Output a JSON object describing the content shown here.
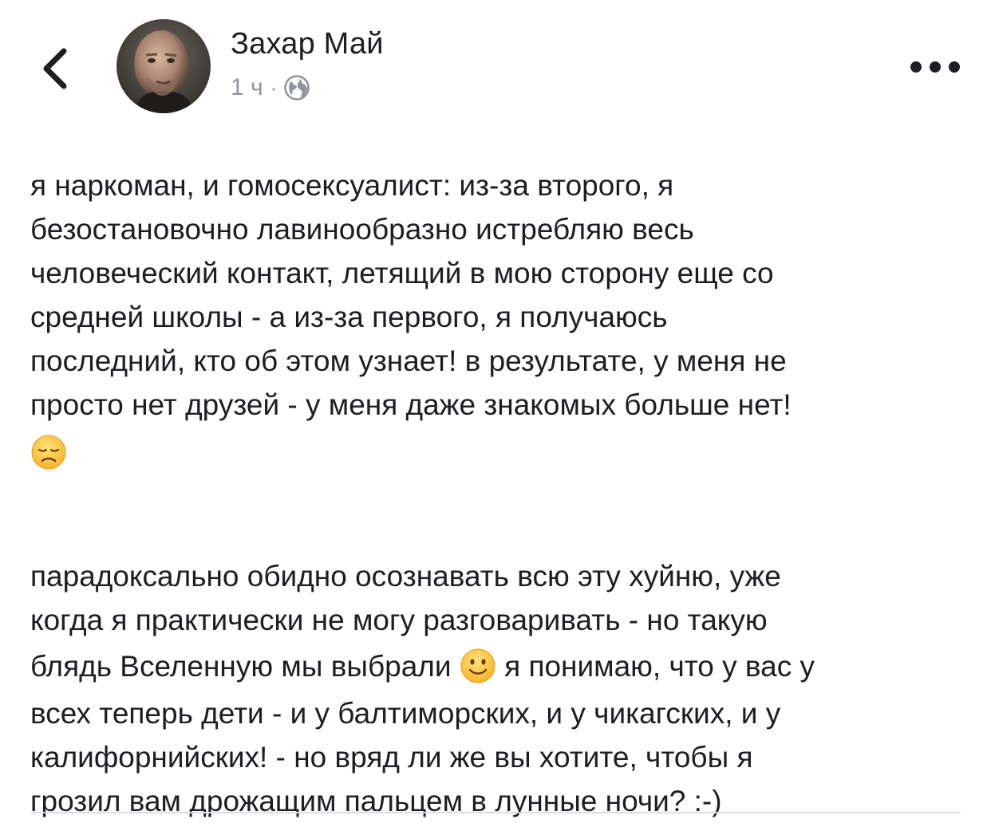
{
  "header": {
    "back_icon": "chevron-left-icon",
    "author_name": "Захар Май",
    "timestamp": "1 ч",
    "separator": "·",
    "privacy_icon": "globe-icon",
    "more_icon": "more-dots-icon"
  },
  "post": {
    "paragraph1": {
      "lines": [
        "я наркоман, и гомосексуалист: из-за второго, я",
        "безостановочно лавинообразно истребляю весь",
        "человеческий контакт, летящий в мою сторону еще со",
        "средней школы - а из-за первого, я получаюсь",
        "последний, кто об этом узнает! в результате, у меня не",
        "просто нет друзей - у меня даже знакомых больше нет!"
      ],
      "trailing_emoji": "disappointed-face-emoji"
    },
    "paragraph2": {
      "line1": "парадоксально обидно осознавать всю эту хуйню, уже",
      "line2": "когда я практически не могу разговаривать - но такую",
      "line3_before_emoji": "блядь Вселенную мы выбрали ",
      "line3_emoji": "slightly-smiling-face-emoji",
      "line3_after_emoji": " я понимаю, что у вас у",
      "line4": "всех теперь дети - и у балтиморских, и у чикагских, и у",
      "line5": "калифорнийских! - но вряд ли же вы хотите, чтобы я",
      "line6": "грозил вам дрожащим пальцем в лунные ночи? :-)"
    }
  },
  "colors": {
    "text": "#1c1e21",
    "meta": "#90949c",
    "icon": "#1c1e21",
    "divider": "#dadde1",
    "emoji_yellow": "#ffcc4d"
  }
}
